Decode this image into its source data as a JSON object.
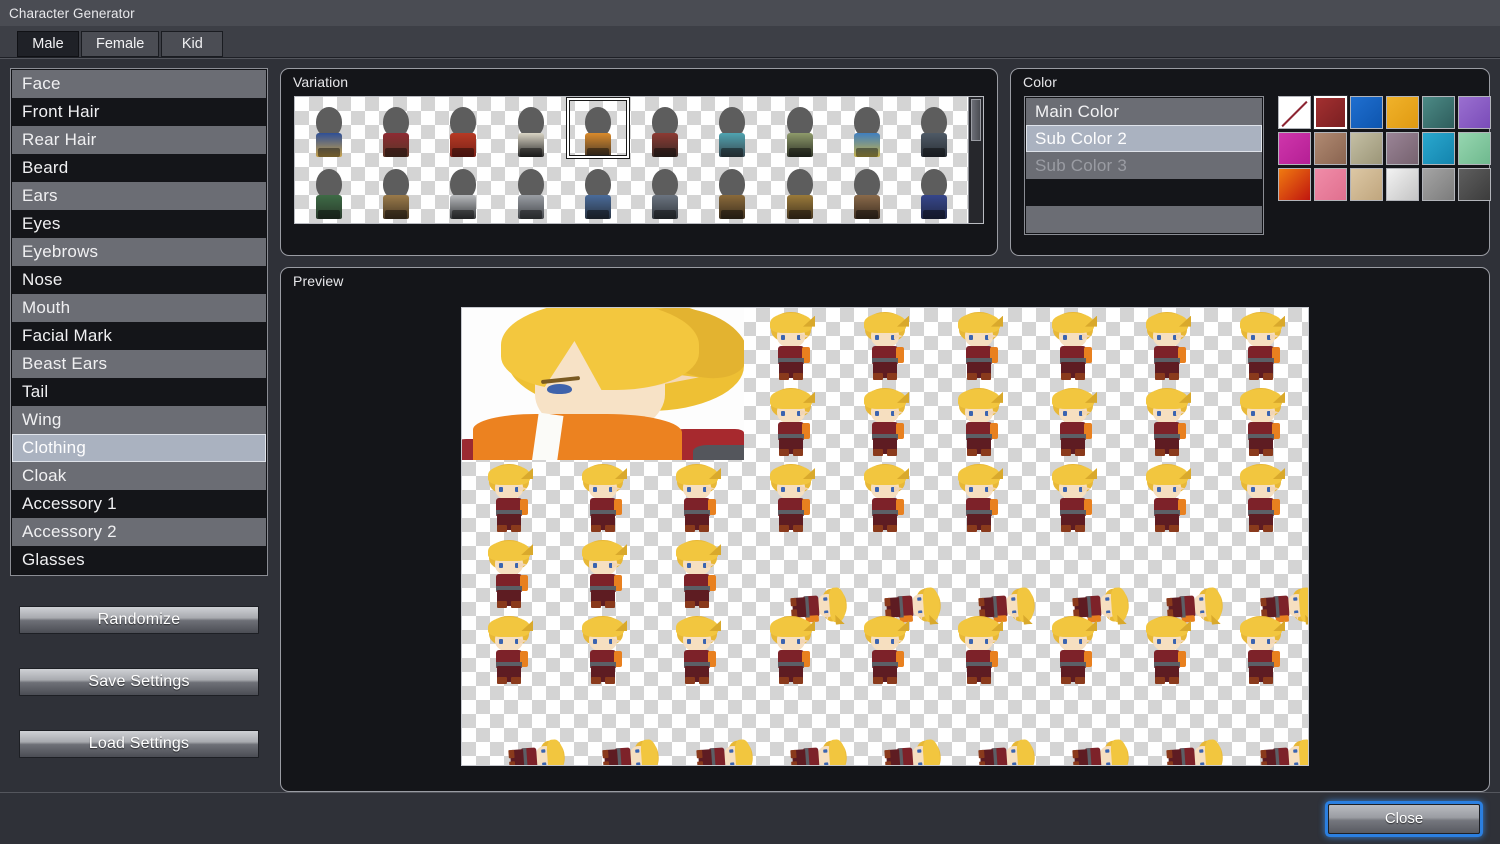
{
  "window": {
    "title": "Character Generator"
  },
  "tabs": [
    {
      "label": "Male",
      "selected": true
    },
    {
      "label": "Female",
      "selected": false
    },
    {
      "label": "Kid",
      "selected": false
    }
  ],
  "parts_list": {
    "items": [
      {
        "label": "Face",
        "selected": false
      },
      {
        "label": "Front Hair",
        "selected": false
      },
      {
        "label": "Rear Hair",
        "selected": false
      },
      {
        "label": "Beard",
        "selected": false
      },
      {
        "label": "Ears",
        "selected": false
      },
      {
        "label": "Eyes",
        "selected": false
      },
      {
        "label": "Eyebrows",
        "selected": false
      },
      {
        "label": "Nose",
        "selected": false
      },
      {
        "label": "Mouth",
        "selected": false
      },
      {
        "label": "Facial Mark",
        "selected": false
      },
      {
        "label": "Beast Ears",
        "selected": false
      },
      {
        "label": "Tail",
        "selected": false
      },
      {
        "label": "Wing",
        "selected": false
      },
      {
        "label": "Clothing",
        "selected": true
      },
      {
        "label": "Cloak",
        "selected": false
      },
      {
        "label": "Accessory 1",
        "selected": false
      },
      {
        "label": "Accessory 2",
        "selected": false
      },
      {
        "label": "Glasses",
        "selected": false
      }
    ]
  },
  "sidebar_buttons": [
    {
      "label": "Randomize"
    },
    {
      "label": "Save Settings"
    },
    {
      "label": "Load Settings"
    }
  ],
  "variation": {
    "label": "Variation",
    "selected_index": 4,
    "cells": [
      {
        "main": "#2f4f96",
        "sub": "#c8a24a"
      },
      {
        "main": "#8d2b33",
        "sub": "#5a3526"
      },
      {
        "main": "#b63a24",
        "sub": "#7a2118"
      },
      {
        "main": "#d9d4c4",
        "sub": "#2b2b2b"
      },
      {
        "main": "#d98a2b",
        "sub": "#4a3a2a"
      },
      {
        "main": "#8c3a33",
        "sub": "#3a2a26"
      },
      {
        "main": "#4fa3b0",
        "sub": "#3a4a52"
      },
      {
        "main": "#8e9a6a",
        "sub": "#2f3328"
      },
      {
        "main": "#3f7fbf",
        "sub": "#c7b24a"
      },
      {
        "main": "#4f5a66",
        "sub": "#2a2f36"
      },
      {
        "main": "#3e6b46",
        "sub": "#2a3a2c"
      },
      {
        "main": "#9a7a4a",
        "sub": "#4a3a26"
      },
      {
        "main": "#b8babd",
        "sub": "#3a3c3f"
      },
      {
        "main": "#9a9ea4",
        "sub": "#44474b"
      },
      {
        "main": "#4a6b9a",
        "sub": "#2a3442"
      },
      {
        "main": "#6b7480",
        "sub": "#34393f"
      },
      {
        "main": "#8a6a3a",
        "sub": "#3e3020"
      },
      {
        "main": "#9a7a3a",
        "sub": "#463620"
      },
      {
        "main": "#8a6a4a",
        "sub": "#3e2f22"
      },
      {
        "main": "#36468a",
        "sub": "#222a4a"
      }
    ]
  },
  "color": {
    "label": "Color",
    "slots": [
      {
        "label": "Main Color",
        "state": "normal",
        "style": "gray"
      },
      {
        "label": "Sub Color 2",
        "state": "selected",
        "style": "selected"
      },
      {
        "label": "Sub Color 3",
        "state": "disabled",
        "style": "gray"
      },
      {
        "label": "",
        "state": "empty",
        "style": "dark"
      },
      {
        "label": "",
        "state": "empty",
        "style": "gray"
      }
    ],
    "selected_swatch_index": 1,
    "swatches": [
      {
        "name": "none",
        "hex": "#ffffff",
        "hex2": "#ffffff"
      },
      {
        "name": "dark-red",
        "hex": "#a33030",
        "hex2": "#7a1f22"
      },
      {
        "name": "blue",
        "hex": "#1f6fd0",
        "hex2": "#0e55ae"
      },
      {
        "name": "gold",
        "hex": "#f0b22a",
        "hex2": "#e09a12"
      },
      {
        "name": "teal",
        "hex": "#4c8a86",
        "hex2": "#2e5d5c"
      },
      {
        "name": "purple",
        "hex": "#9a6fd0",
        "hex2": "#7a4cb8"
      },
      {
        "name": "magenta",
        "hex": "#cf36ab",
        "hex2": "#b51f95"
      },
      {
        "name": "brown",
        "hex": "#b08a72",
        "hex2": "#8a6450"
      },
      {
        "name": "khaki",
        "hex": "#c4bfa4",
        "hex2": "#9c9678"
      },
      {
        "name": "mauve",
        "hex": "#9a8496",
        "hex2": "#76626f"
      },
      {
        "name": "cyan",
        "hex": "#2aa8cf",
        "hex2": "#1484ad"
      },
      {
        "name": "mint",
        "hex": "#96d6b0",
        "hex2": "#6fb98e"
      },
      {
        "name": "orange-red",
        "hex": "#f07a10",
        "hex2": "#c0160f"
      },
      {
        "name": "pink",
        "hex": "#f08ca8",
        "hex2": "#e0708f"
      },
      {
        "name": "tan",
        "hex": "#dcc7a4",
        "hex2": "#c0a67e"
      },
      {
        "name": "silver",
        "hex": "#f2f2f2",
        "hex2": "#c4c4c4"
      },
      {
        "name": "gray",
        "hex": "#a4a4a4",
        "hex2": "#7c7c7c"
      },
      {
        "name": "dark-gray",
        "hex": "#5e5e5e",
        "hex2": "#3c3c3c"
      }
    ]
  },
  "preview": {
    "label": "Preview",
    "columns": 9,
    "rows": 6,
    "face_span": {
      "cols": 3,
      "rows": 2
    },
    "sprite_poses": [
      "front",
      "front",
      "front",
      "front",
      "front",
      "front",
      "side",
      "side",
      "side",
      "side",
      "side",
      "side",
      "side",
      "side",
      "side",
      "side",
      "side",
      "side",
      "back",
      "back",
      "back",
      "back",
      "back",
      "back",
      "lying",
      "lying",
      "lying",
      "lying",
      "lying",
      "lying"
    ]
  },
  "bottom_bar": {
    "close_label": "Close"
  },
  "theme": {
    "accent_focus": "#2b7fe0",
    "selection": "#aab2c0",
    "panel_bg": "#141519",
    "window_bg": "#2f3138",
    "titlebar_bg": "#4a4c53"
  }
}
